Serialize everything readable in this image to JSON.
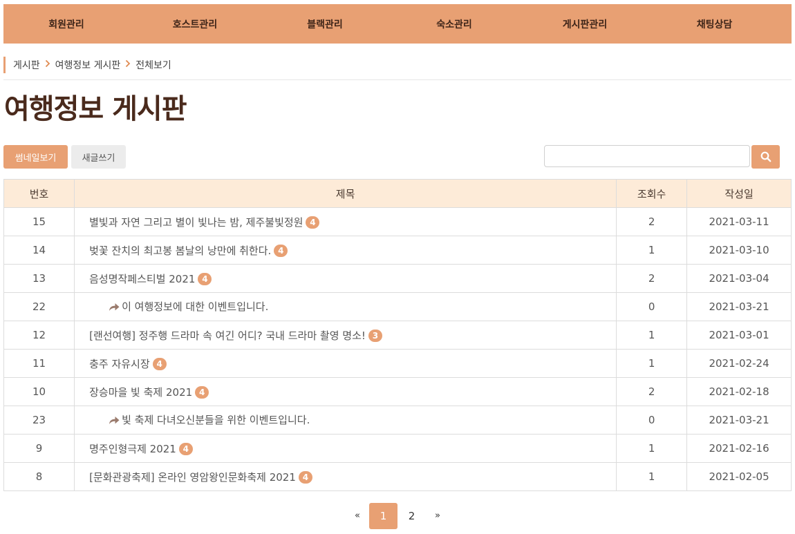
{
  "nav": {
    "items": [
      {
        "label": "회원관리",
        "w": 182
      },
      {
        "label": "호스트관리",
        "w": 190
      },
      {
        "label": "블랙관리",
        "w": 186
      },
      {
        "label": "숙소관리",
        "w": 188
      },
      {
        "label": "게시판관리",
        "w": 190
      },
      {
        "label": "채팅상담",
        "w": 185
      }
    ]
  },
  "breadcrumb": {
    "items": [
      "게시판",
      "여행정보 게시판",
      "전체보기"
    ]
  },
  "page_title": "여행정보 게시판",
  "toolbar": {
    "thumbnail_label": "썸네일보기",
    "write_label": "새글쓰기",
    "search_value": "",
    "search_placeholder": ""
  },
  "table": {
    "headers": [
      "번호",
      "제목",
      "조회수",
      "작성일"
    ],
    "rows": [
      {
        "num": "15",
        "title": "별빛과 자연 그리고 별이 빛나는 밤, 제주불빛정원",
        "badge": "4",
        "reply": false,
        "views": "2",
        "date": "2021-03-11"
      },
      {
        "num": "14",
        "title": "벚꽃 잔치의 최고봉 봄날의 낭만에 취한다.",
        "badge": "4",
        "reply": false,
        "views": "1",
        "date": "2021-03-10"
      },
      {
        "num": "13",
        "title": "음성명작페스티벌 2021",
        "badge": "4",
        "reply": false,
        "views": "2",
        "date": "2021-03-04"
      },
      {
        "num": "22",
        "title": "이 여행정보에 대한 이벤트입니다.",
        "badge": "",
        "reply": true,
        "views": "0",
        "date": "2021-03-21"
      },
      {
        "num": "12",
        "title": "[랜선여행] 정주행 드라마 속 여긴 어디? 국내 드라마 촬영 명소!",
        "badge": "3",
        "reply": false,
        "views": "1",
        "date": "2021-03-01"
      },
      {
        "num": "11",
        "title": "충주 자유시장",
        "badge": "4",
        "reply": false,
        "views": "1",
        "date": "2021-02-24"
      },
      {
        "num": "10",
        "title": "장승마을 빛 축제 2021",
        "badge": "4",
        "reply": false,
        "views": "2",
        "date": "2021-02-18"
      },
      {
        "num": "23",
        "title": "빛 축제 다녀오신분들을 위한 이벤트입니다.",
        "badge": "",
        "reply": true,
        "views": "0",
        "date": "2021-03-21"
      },
      {
        "num": "9",
        "title": "명주인형극제 2021",
        "badge": "4",
        "reply": false,
        "views": "1",
        "date": "2021-02-16"
      },
      {
        "num": "8",
        "title": "[문화관광축제] 온라인 영암왕인문화축제 2021",
        "badge": "4",
        "reply": false,
        "views": "1",
        "date": "2021-02-05"
      }
    ]
  },
  "pagination": {
    "prev": "«",
    "pages": [
      "1",
      "2"
    ],
    "active": "1",
    "next": "»"
  },
  "icons": {
    "search": "search-icon",
    "reply": "reply-arrow-icon",
    "breadcrumb_sep": "chevron-right-icon"
  },
  "colors": {
    "accent": "#e8a073",
    "title": "#4a2a1c",
    "table_header_bg": "#fdebd8"
  }
}
